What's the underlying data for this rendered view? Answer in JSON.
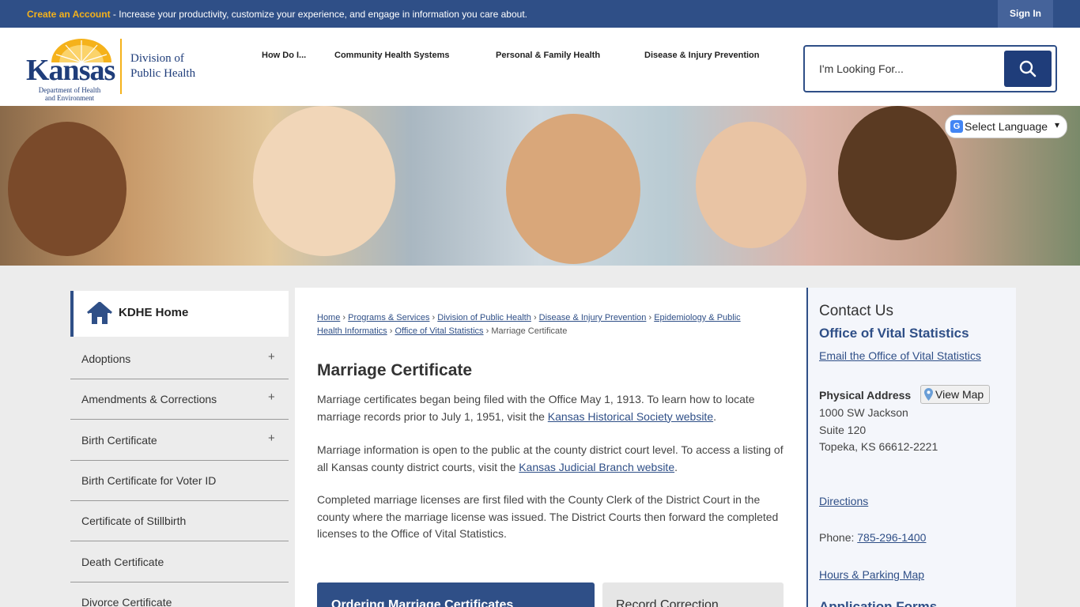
{
  "topbar": {
    "create_label": "Create an Account",
    "message": " - Increase your productivity, customize your experience, and engage in information you care about.",
    "signin_label": "Sign In"
  },
  "logo": {
    "state": "Kansas",
    "department": "Department of Health and Environment",
    "division_line1": "Division of",
    "division_line2": "Public Health"
  },
  "nav": [
    {
      "label": "How Do I..."
    },
    {
      "label": "Community Health Systems"
    },
    {
      "label": "Personal & Family Health"
    },
    {
      "label": "Disease & Injury Prevention"
    }
  ],
  "search": {
    "placeholder": "I'm Looking For..."
  },
  "language": {
    "label": "Select Language"
  },
  "sidebar": {
    "home_label": "KDHE Home",
    "items": [
      {
        "label": "Adoptions",
        "expand": "+"
      },
      {
        "label": "Amendments & Corrections",
        "expand": "+"
      },
      {
        "label": "Birth Certificate",
        "expand": "+"
      },
      {
        "label": "Birth Certificate for Voter ID"
      },
      {
        "label": "Certificate of Stillbirth"
      },
      {
        "label": "Death Certificate"
      },
      {
        "label": "Divorce Certificate"
      }
    ]
  },
  "breadcrumb": {
    "items": [
      "Home",
      "Programs & Services",
      "Division of Public Health",
      "Disease & Injury Prevention",
      "Epidemiology & Public Health Informatics",
      "Office of Vital Statistics"
    ],
    "current": "Marriage Certificate",
    "sep": "›"
  },
  "main": {
    "title": "Marriage Certificate",
    "p1_text": "Marriage certificates began being filed with the Office May 1, 1913. To learn how to locate marriage records prior to July 1, 1951, visit the ",
    "p1_link": "Kansas Historical Society website",
    "p1_end": ".",
    "p2_text": "Marriage information is open to the public at the county district court level. To access a listing of all Kansas county district courts, visit the ",
    "p2_link": "Kansas Judicial Branch website",
    "p2_end": ".",
    "p3_text": "Completed marriage licenses are first filed with the County Clerk of the District Court in the county where the marriage license was issued. The District Courts then forward the completed licenses to the Office of Vital Statistics.",
    "tab_active": "Ordering Marriage Certificates",
    "tab_inactive": "Record Correction"
  },
  "contact": {
    "heading": "Contact Us",
    "org": "Office of Vital Statistics",
    "email_link": "Email the Office of Vital Statistics",
    "address_label": "Physical Address",
    "map_label": "View Map",
    "address1": "1000 SW Jackson",
    "address2": "Suite 120",
    "address3": "Topeka, KS 66612-2221",
    "directions": "Directions",
    "phone_label": "Phone: ",
    "phone": "785-296-1400",
    "hours_link": "Hours & Parking Map",
    "cut_heading": "Application Forms"
  },
  "colors": {
    "brand": "#2f4f87",
    "accent": "#f5b21b",
    "dark_blue": "#1f3d7a"
  }
}
